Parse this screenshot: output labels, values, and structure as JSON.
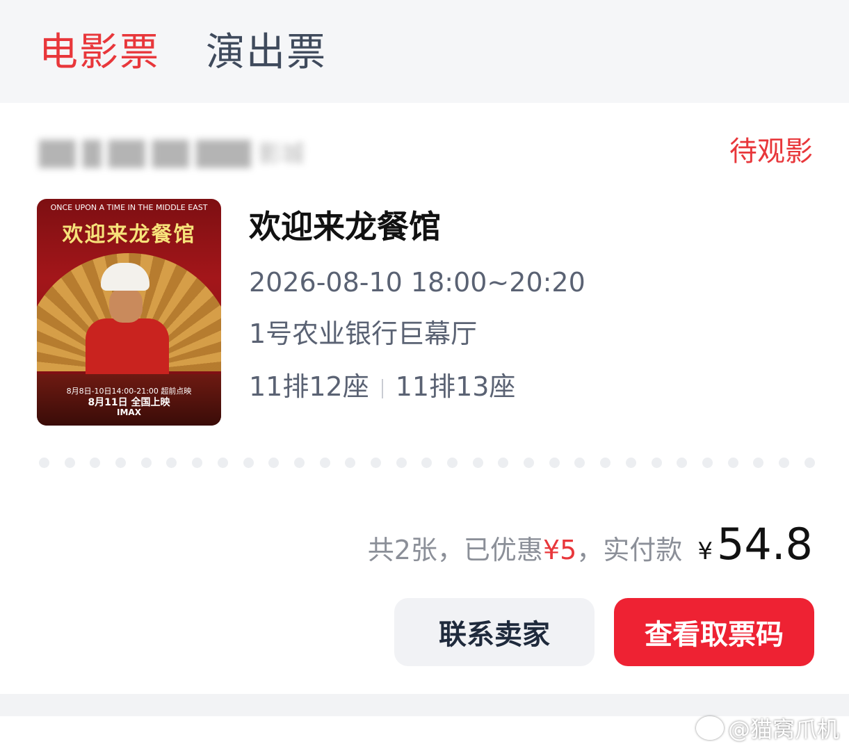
{
  "tabs": [
    {
      "label": "电影票",
      "active": true
    },
    {
      "label": "演出票",
      "active": false
    }
  ],
  "order": {
    "status": "待观影",
    "movie_title": "欢迎来龙餐馆",
    "showtime": "2026-08-10 18:00~20:20",
    "hall": "1号农业银行巨幕厅",
    "seats": [
      "11排12座",
      "11排13座"
    ],
    "summary": {
      "count_text": "共2张，已优惠",
      "discount": "¥5",
      "paid_text": "，实付款",
      "currency": "¥",
      "amount": "54.8"
    },
    "buttons": {
      "contact_seller": "联系卖家",
      "view_code": "查看取票码"
    }
  },
  "poster": {
    "title": "欢迎来龙餐馆",
    "line1": "ONCE UPON A TIME IN THE MIDDLE EAST",
    "line2": "8月8日-10日14:00-21:00 超前点映",
    "line3": "8月11日 全国上映",
    "line4": "IMAX"
  },
  "watermark": "@猫窝爪机",
  "colors": {
    "accent": "#e8373b",
    "primary_button": "#ee2233",
    "secondary_button": "#f1f2f5"
  }
}
